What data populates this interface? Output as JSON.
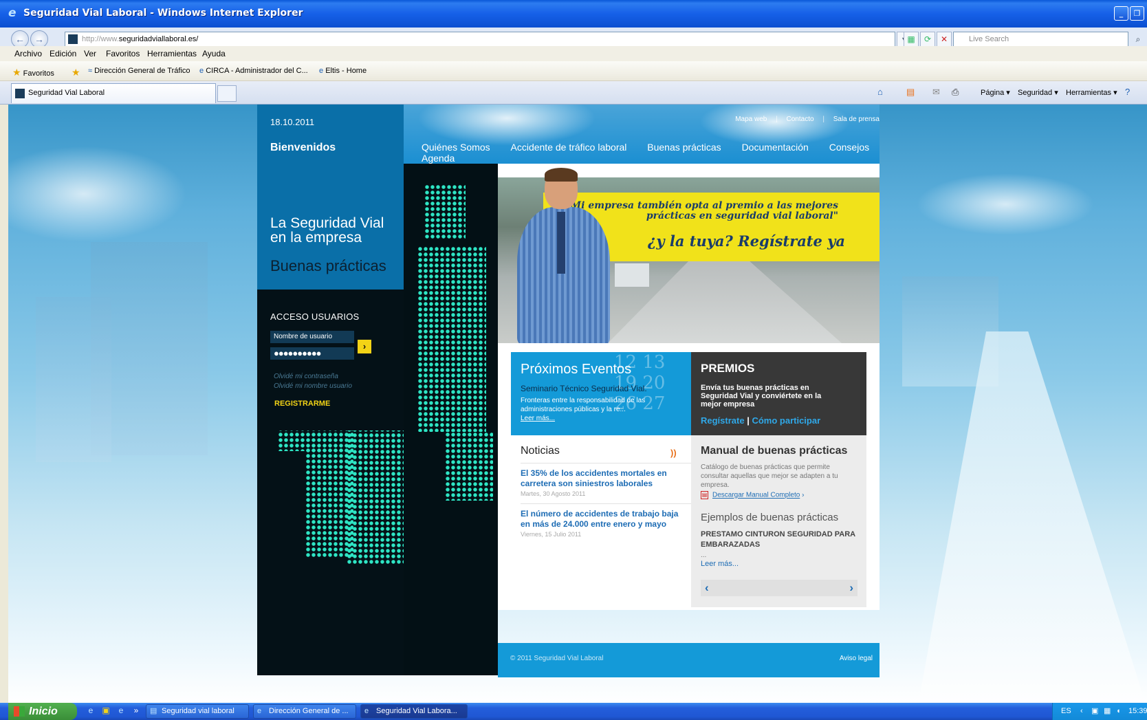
{
  "window": {
    "title": "Seguridad Vial Laboral - Windows Internet Explorer",
    "minimize": "_",
    "restore": "❐",
    "close": "✕"
  },
  "address": {
    "url_prefix": "http://www.",
    "url_domain": "seguridadviallaboral.es/",
    "search_placeholder": "Live Search"
  },
  "menu": [
    "Archivo",
    "Edición",
    "Ver",
    "Favoritos",
    "Herramientas",
    "Ayuda"
  ],
  "favorites": {
    "label": "Favoritos",
    "links": [
      "Dirección General de Tráfico",
      "CIRCA - Administrador del C...",
      "Eltis - Home"
    ]
  },
  "tab": {
    "label": "Seguridad Vial Laboral"
  },
  "commandbar": [
    "Página ▾",
    "Seguridad ▾",
    "Herramientas ▾"
  ],
  "site": {
    "date": "18.10.2011",
    "welcome": "Bienvenidos",
    "tagline_line1": "La Seguridad Vial",
    "tagline_line2": "en la empresa",
    "tagline_sub": "Buenas prácticas",
    "top_links": [
      "Mapa web",
      "Contacto",
      "Sala de prensa"
    ],
    "nav": [
      "Quiénes Somos",
      "Accidente de tráfico laboral",
      "Buenas prácticas",
      "Documentación",
      "Consejos",
      "Agenda"
    ],
    "login": {
      "title": "ACCESO USUARIOS",
      "user_placeholder": "Nombre de usuario",
      "password_value": "●●●●●●●●●●",
      "go": "›",
      "forgot_password": "Olvidé mi contraseña",
      "forgot_user": "Olvidé mi nombre usuario",
      "register": "REGISTRARME"
    },
    "hero": {
      "quote_line1": "\"Mi empresa también opta al premio a las mejores",
      "quote_line2": "prácticas en seguridad vial laboral\"",
      "cta": "¿y la tuya? Regístrate ya"
    },
    "events": {
      "title": "Próximos Eventos",
      "item_title": "Seminario Técnico Seguridad Vial.",
      "item_desc": "Fronteras entre la responsabilidad de las administraciones públicas y la re...",
      "more": "Leer más...",
      "bg_numbers": "12 13 19 20 26 27"
    },
    "premios": {
      "title": "PREMIOS",
      "text": "Envía tus buenas prácticas en Seguridad Vial y conviértete en la mejor empresa",
      "link1": "Regístrate",
      "separator": "|",
      "link2": "Cómo participar"
    },
    "news": {
      "title": "Noticias",
      "items": [
        {
          "title": "El 35% de los accidentes mortales en carretera son siniestros laborales",
          "date": "Martes, 30 Agosto 2011"
        },
        {
          "title": "El número de accidentes de trabajo baja en más de 24.000 entre enero y mayo",
          "date": "Viernes, 15 Julio 2011"
        }
      ]
    },
    "manual": {
      "title": "Manual de buenas prácticas",
      "desc": "Catálogo de buenas prácticas que permite consultar aquellas que mejor se adapten a tu empresa.",
      "download": "Descargar Manual Completo",
      "download_arrow": "›",
      "examples_title": "Ejemplos de buenas prácticas",
      "example": "PRESTAMO CINTURON SEGURIDAD PARA EMBARAZADAS",
      "ellipsis": "...",
      "more": "Leer más...",
      "prev": "‹",
      "next": "›"
    },
    "footer": {
      "copyright": "© 2011 Seguridad Vial Laboral",
      "legal": "Aviso legal"
    }
  },
  "taskbar": {
    "start": "Inicio",
    "tasks": [
      "Seguridad vial laboral",
      "Dirección General de ...",
      "Seguridad Vial Labora..."
    ],
    "lang": "ES",
    "time": "15:39"
  },
  "colors": {
    "site_blue": "#149ad8",
    "dark_panel": "#041117",
    "yellow": "#f3d316",
    "link_blue": "#1d6cb4"
  }
}
